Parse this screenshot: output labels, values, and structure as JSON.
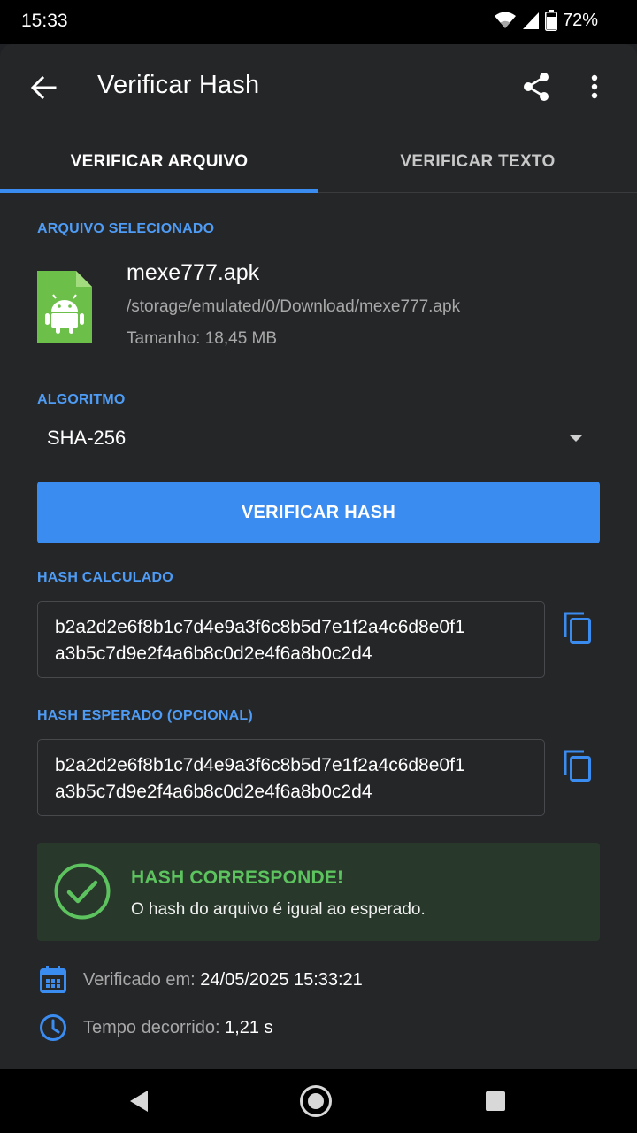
{
  "status_bar": {
    "time": "15:33",
    "battery": "72%"
  },
  "toolbar": {
    "title": "Verificar Hash"
  },
  "tabs": [
    {
      "label": "VERIFICAR ARQUIVO",
      "active": true
    },
    {
      "label": "VERIFICAR TEXTO",
      "active": false
    }
  ],
  "file": {
    "section_label": "ARQUIVO SELECIONADO",
    "name": "mexe777.apk",
    "path": "/storage/emulated/0/Download/mexe777.apk",
    "size": "Tamanho: 18,45 MB"
  },
  "algorithm": {
    "section_label": "ALGORITMO",
    "selected": "SHA-256"
  },
  "verify_button": {
    "label": "VERIFICAR HASH"
  },
  "calculated_hash": {
    "section_label": "HASH CALCULADO",
    "line1": "b2a2d2e6f8b1c7d4e9a3f6c8b5d7e1f2a4c6d8e0f1",
    "line2": "a3b5c7d9e2f4a6b8c0d2e4f6a8b0c2d4"
  },
  "expected_hash": {
    "section_label": "HASH ESPERADO (OPCIONAL)",
    "line1": "b2a2d2e6f8b1c7d4e9a3f6c8b5d7e1f2a4c6d8e0f1",
    "line2": "a3b5c7d9e2f4a6b8c0d2e4f6a8b0c2d4"
  },
  "result": {
    "title": "HASH CORRESPONDE!",
    "message": "O hash do arquivo é igual ao esperado."
  },
  "details": {
    "verified_label": "Verificado em: ",
    "verified_value": "24/05/2025 15:33:21",
    "elapsed_label": "Tempo decorrido: ",
    "elapsed_value": "1,21 s"
  },
  "colors": {
    "accent": "#3b8cf0",
    "success": "#5cc35e",
    "background": "#252628",
    "apk_icon": "#6cc04a"
  },
  "icons": [
    "back-arrow-icon",
    "share-icon",
    "more-vert-icon",
    "apk-file-icon",
    "dropdown-arrow-icon",
    "copy-icon",
    "check-circle-icon",
    "calendar-icon",
    "clock-icon"
  ]
}
